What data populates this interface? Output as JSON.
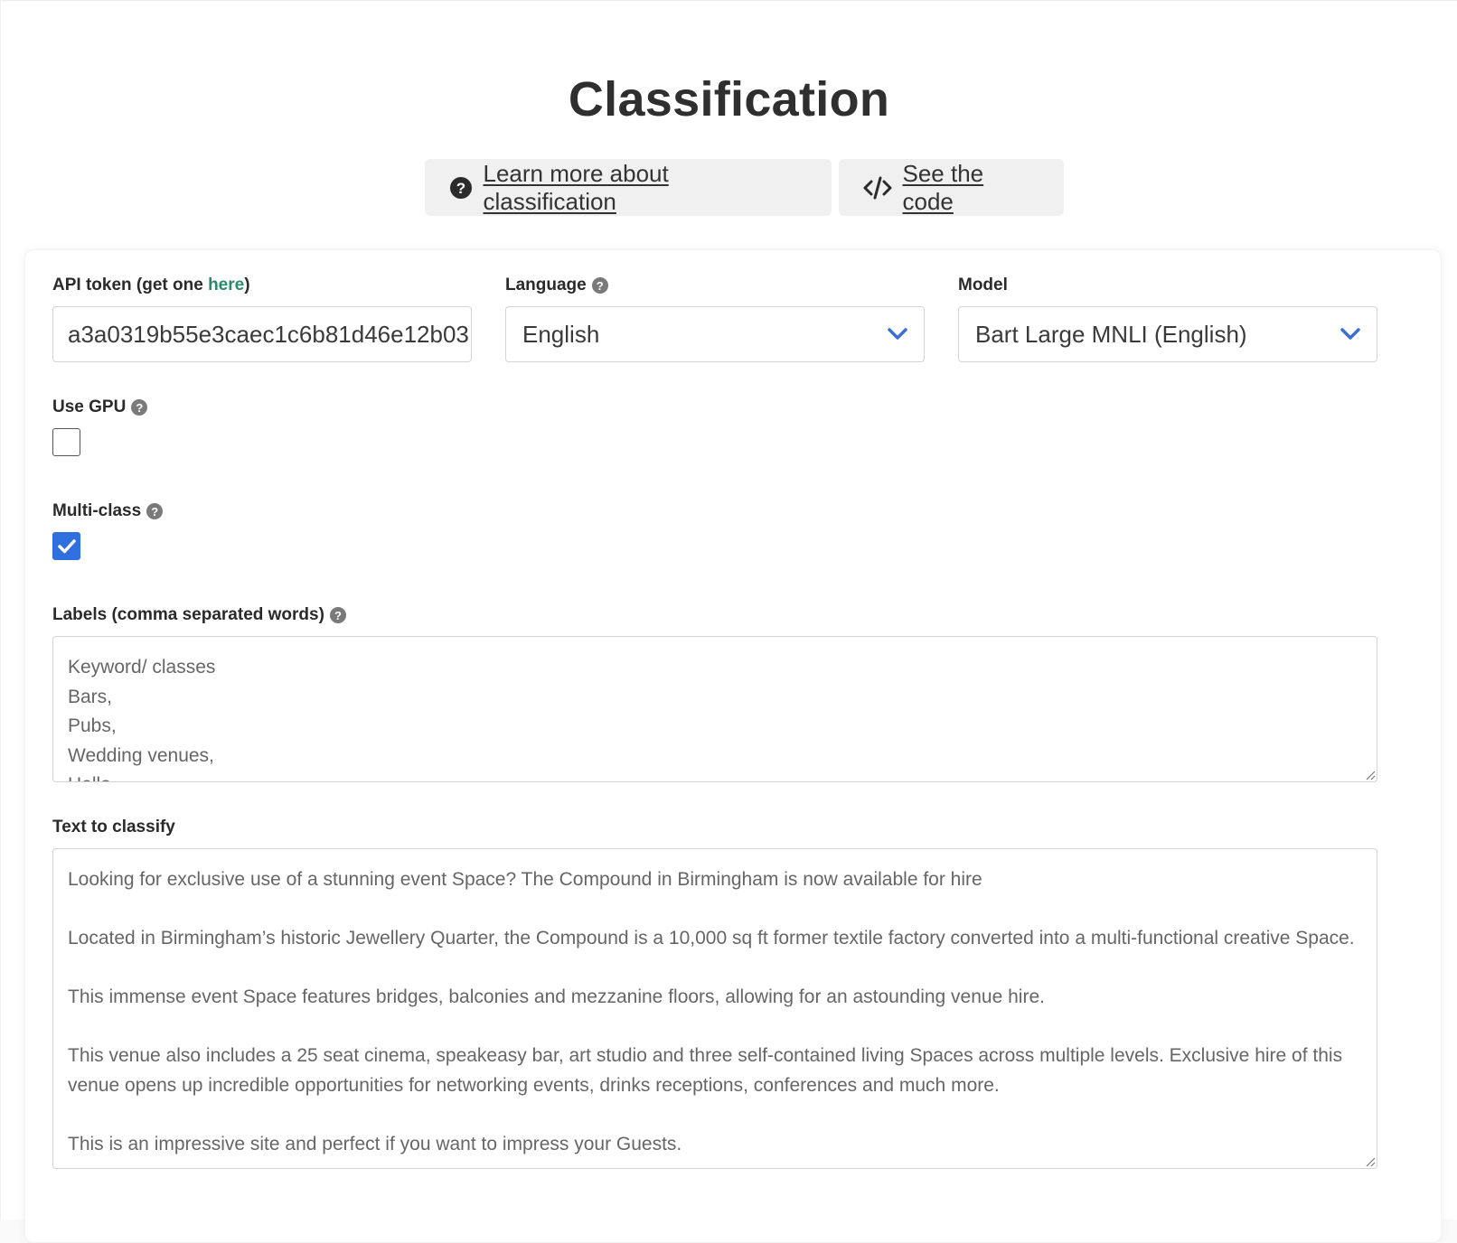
{
  "page": {
    "title": "Classification"
  },
  "buttons": {
    "learn_more": "Learn more about classification",
    "see_code": "See the code"
  },
  "form": {
    "api_token": {
      "label_prefix": "API token (get one ",
      "label_link": "here",
      "label_suffix": ")",
      "value": "a3a0319b55e3caec1c6b81d46e12b03"
    },
    "language": {
      "label": "Language",
      "selected": "English"
    },
    "model": {
      "label": "Model",
      "selected": "Bart Large MNLI (English)"
    },
    "use_gpu": {
      "label": "Use GPU",
      "checked": false
    },
    "multi_class": {
      "label": "Multi-class",
      "checked": true
    },
    "labels": {
      "label": "Labels (comma separated words)",
      "value": "Keyword/ classes\nBars,\nPubs,\nWedding venues,\nHello"
    },
    "text_to_classify": {
      "label": "Text to classify",
      "value": "Looking for exclusive use of a stunning event Space? The Compound in Birmingham is now available for hire\n\nLocated in Birmingham’s historic Jewellery Quarter, the Compound is a 10,000 sq ft former textile factory converted into a multi-functional creative Space.\n\nThis immense event Space features bridges, balconies and mezzanine floors, allowing for an astounding venue hire.\n\nThis venue also includes a 25 seat cinema, speakeasy bar, art studio and three self-contained living Spaces across multiple levels. Exclusive hire of this venue opens up incredible opportunities for networking events, drinks receptions, conferences and much more.\n\nThis is an impressive site and perfect if you want to impress your Guests."
    }
  },
  "colors": {
    "accent_blue": "#2f6fe0",
    "link_green": "#2a8a6e",
    "chevron_blue": "#3b6fd6"
  },
  "icons": {
    "learn_more": "question-circle-icon",
    "see_code": "code-icon",
    "help": "help-icon",
    "select": "chevron-down-icon"
  }
}
